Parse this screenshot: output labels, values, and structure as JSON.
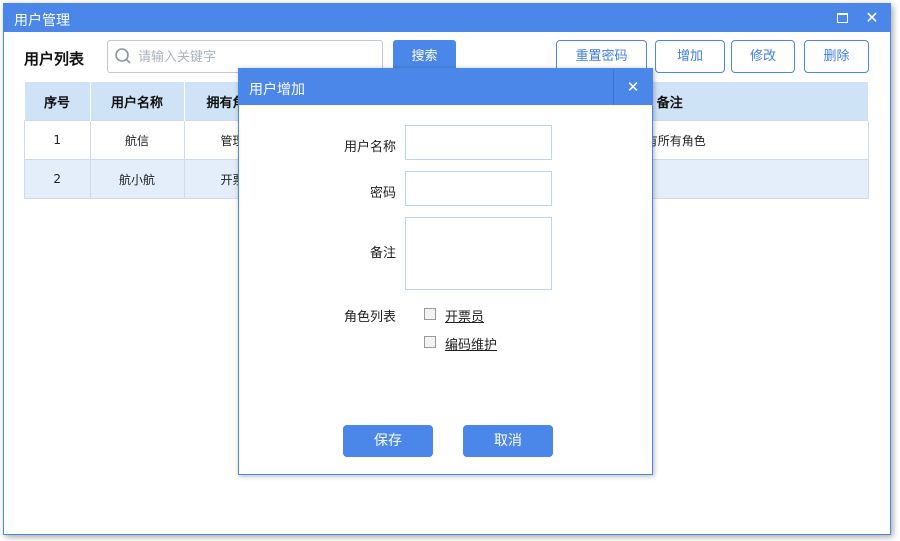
{
  "window": {
    "title": "用户管理",
    "maximize_icon": "maximize-icon",
    "close_icon": "close-icon"
  },
  "toolbar": {
    "list_title": "用户列表",
    "search_placeholder": "请输入关键字",
    "search_button": "搜索",
    "reset_password": "重置密码",
    "add": "增加",
    "edit": "修改",
    "delete": "删除"
  },
  "table": {
    "headers": [
      "序号",
      "用户名称",
      "拥有角色",
      "",
      "备注"
    ],
    "rows": [
      {
        "no": "1",
        "name": "航信",
        "roles": "管理",
        "note": "拥有所有角色"
      },
      {
        "no": "2",
        "name": "航小航",
        "roles": "开票",
        "note": ""
      }
    ]
  },
  "dialog": {
    "title": "用户增加",
    "close_icon": "close-icon",
    "username_label": "用户名称",
    "password_label": "密码",
    "note_label": "备注",
    "roles_label": "角色列表",
    "roles": [
      "开票员",
      "编码维护"
    ],
    "save_button": "保存",
    "cancel_button": "取消"
  },
  "colors": {
    "accent": "#4a87e8",
    "header_bg": "#cfe3f7",
    "alt_row": "#e3eefa"
  }
}
